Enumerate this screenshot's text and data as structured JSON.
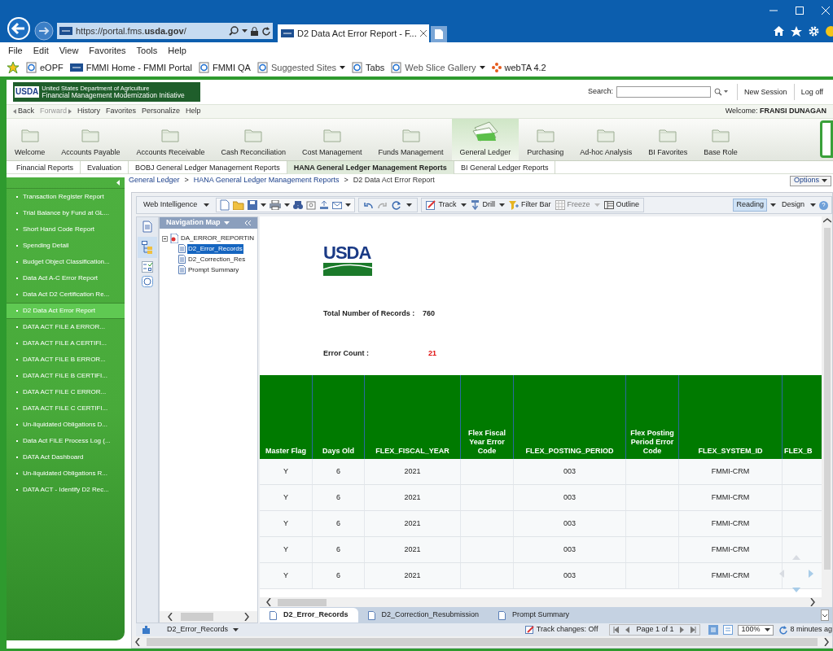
{
  "browser": {
    "address": "https://portal.fms.**usda.gov**/",
    "tab_title": "D2 Data Act Error Report - F...",
    "menu": [
      "File",
      "Edit",
      "View",
      "Favorites",
      "Tools",
      "Help"
    ],
    "favorites": [
      {
        "label": "eOPF",
        "has_menu": false
      },
      {
        "label": "FMMI Home - FMMI Portal",
        "has_menu": false
      },
      {
        "label": "FMMI QA",
        "has_menu": false
      },
      {
        "label": "Suggested Sites",
        "has_menu": true
      },
      {
        "label": "Tabs",
        "has_menu": false
      },
      {
        "label": "Web Slice Gallery",
        "has_menu": true
      },
      {
        "label": "webTA 4.2",
        "has_menu": false
      }
    ]
  },
  "portal": {
    "logo_text": "USDA",
    "org_name": "United States Department of Agriculture",
    "system_name": "Financial Management Modernization Initiative",
    "search_label": "Search:",
    "header_links": [
      "New Session",
      "Log off"
    ],
    "history": [
      {
        "label": "Back",
        "disabled": false
      },
      {
        "label": "Forward",
        "disabled": true
      },
      {
        "label": "History",
        "disabled": false
      },
      {
        "label": "Favorites",
        "disabled": false
      },
      {
        "label": "Personalize",
        "disabled": false
      },
      {
        "label": "Help",
        "disabled": false
      }
    ],
    "welcome": "Welcome: **FRANSI DUNAGAN**"
  },
  "top_nav": [
    {
      "label": "Welcome",
      "selected": false
    },
    {
      "label": "Accounts Payable",
      "selected": false
    },
    {
      "label": "Accounts Receivable",
      "selected": false
    },
    {
      "label": "Cash Reconciliation",
      "selected": false
    },
    {
      "label": "Cost Management",
      "selected": false
    },
    {
      "label": "Funds Management",
      "selected": false
    },
    {
      "label": "General Ledger",
      "selected": true
    },
    {
      "label": "Purchasing",
      "selected": false
    },
    {
      "label": "Ad-hoc Analysis",
      "selected": false
    },
    {
      "label": "BI Favorites",
      "selected": false
    },
    {
      "label": "Base Role",
      "selected": false
    }
  ],
  "sub_tabs": [
    {
      "label": "Financial Reports",
      "selected": false
    },
    {
      "label": "Evaluation",
      "selected": false
    },
    {
      "label": "BOBJ General Ledger Management Reports",
      "selected": false
    },
    {
      "label": "HANA General Ledger Management Reports",
      "selected": true
    },
    {
      "label": "BI General Ledger Reports",
      "selected": false
    }
  ],
  "breadcrumb": {
    "items": [
      "General Ledger",
      "HANA General Ledger Management Reports",
      "D2 Data Act Error Report"
    ],
    "separator": ">"
  },
  "options_label": "Options",
  "sidebar": {
    "items": [
      {
        "label": "Transaction Register Report",
        "selected": false
      },
      {
        "label": "Trial Balance by Fund at GL...",
        "selected": false
      },
      {
        "label": "Short Hand Code Report",
        "selected": false
      },
      {
        "label": "Spending Detail",
        "selected": false
      },
      {
        "label": "Budget Object Classification...",
        "selected": false
      },
      {
        "label": "Data Act A-C Error Report",
        "selected": false
      },
      {
        "label": "Data Act D2 Certification Re...",
        "selected": false
      },
      {
        "label": "D2 Data Act Error Report",
        "selected": true
      },
      {
        "label": "DATA ACT FILE A ERROR...",
        "selected": false
      },
      {
        "label": "DATA ACT FILE A CERTIFI...",
        "selected": false
      },
      {
        "label": "DATA ACT FILE B ERROR...",
        "selected": false
      },
      {
        "label": "DATA ACT FILE B CERTIFI...",
        "selected": false
      },
      {
        "label": "DATA ACT FILE C ERROR...",
        "selected": false
      },
      {
        "label": "DATA ACT FILE C CERTIFI...",
        "selected": false
      },
      {
        "label": "Un-liquidated Obligations D...",
        "selected": false
      },
      {
        "label": "Data Act FILE Process Log (...",
        "selected": false
      },
      {
        "label": "DATA Act Dashboard",
        "selected": false
      },
      {
        "label": "Un-liquidated Obligations R...",
        "selected": false
      },
      {
        "label": "DATA ACT - Identify D2 Rec...",
        "selected": false
      }
    ]
  },
  "toolbar": {
    "app_menu": "Web Intelligence",
    "tools": [
      {
        "label": "Track",
        "disabled": false
      },
      {
        "label": "Drill",
        "disabled": false
      },
      {
        "label": "Filter Bar",
        "disabled": false
      },
      {
        "label": "Freeze",
        "disabled": true
      },
      {
        "label": "Outline",
        "disabled": false
      }
    ],
    "modes": [
      {
        "label": "Reading",
        "selected": true
      },
      {
        "label": "Design",
        "selected": false
      }
    ]
  },
  "navigation_map": {
    "title": "Navigation Map",
    "root": "DA_ERROR_REPORTIN",
    "children": [
      {
        "label": "D2_Error_Records",
        "selected": true
      },
      {
        "label": "D2_Correction_Res",
        "selected": false
      },
      {
        "label": "Prompt Summary",
        "selected": false
      }
    ]
  },
  "report": {
    "logo_text": "USDA",
    "total_label": "Total Number of Records :",
    "total_value": "760",
    "error_label": "Error Count :",
    "error_value": "21",
    "table": {
      "columns": [
        "Master Flag",
        "Days Old",
        "FLEX_FISCAL_YEAR",
        "Flex Fiscal Year Error Code",
        "FLEX_POSTING_PERIOD",
        "Flex Posting Period Error Code",
        "FLEX_SYSTEM_ID",
        "FLEX_B"
      ],
      "rows": [
        [
          "Y",
          "6",
          "2021",
          null,
          "003",
          null,
          "FMMI-CRM",
          null
        ],
        [
          "Y",
          "6",
          "2021",
          null,
          "003",
          null,
          "FMMI-CRM",
          null
        ],
        [
          "Y",
          "6",
          "2021",
          null,
          "003",
          null,
          "FMMI-CRM",
          null
        ],
        [
          "Y",
          "6",
          "2021",
          null,
          "003",
          null,
          "FMMI-CRM",
          null
        ],
        [
          "Y",
          "6",
          "2021",
          null,
          "003",
          null,
          "FMMI-CRM",
          null
        ]
      ]
    }
  },
  "report_tabs": [
    {
      "label": "D2_Error_Records",
      "selected": true
    },
    {
      "label": "D2_Correction_Resubmission",
      "selected": false
    },
    {
      "label": "Prompt Summary",
      "selected": false
    }
  ],
  "status_bar": {
    "document": "D2_Error_Records",
    "track_changes": "Track changes: Off",
    "page": "Page 1 of 1",
    "zoom": "100%",
    "refreshed": "8 minutes ag"
  }
}
